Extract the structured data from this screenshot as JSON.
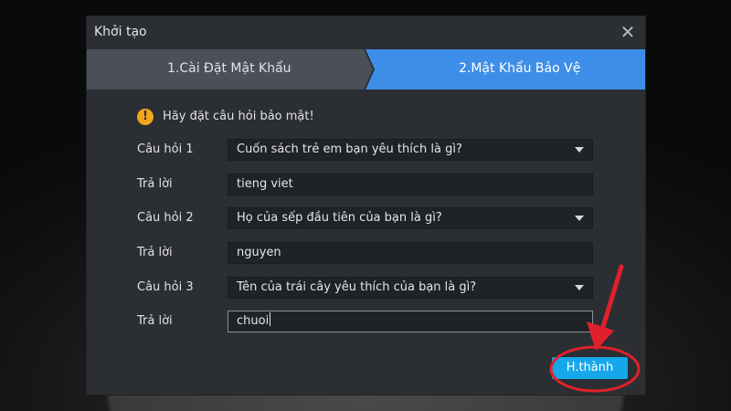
{
  "dialog": {
    "title": "Khởi tạo",
    "close_glyph": "✕"
  },
  "steps": [
    {
      "label": "1.Cài Đặt Mật Khẩu",
      "active": false
    },
    {
      "label": "2.Mật Khẩu Bảo Vệ",
      "active": true
    }
  ],
  "notice": {
    "icon": "warning-icon",
    "icon_glyph": "!",
    "text": "Hãy đặt câu hỏi bảo mật!"
  },
  "form": {
    "q1_label": "Câu hỏi 1",
    "q1_value": "Cuốn sách trẻ em bạn yêu thích là gì?",
    "a1_label": "Trả lời",
    "a1_value": "tieng viet",
    "q2_label": "Câu hỏi 2",
    "q2_value": "Họ của sếp đầu tiên của bạn là gì?",
    "a2_label": "Trả lời",
    "a2_value": "nguyen",
    "q3_label": "Câu hỏi 3",
    "q3_value": "Tên của trái cây yêu thích của bạn là gì?",
    "a3_label": "Trả lời",
    "a3_value": "chuoi"
  },
  "finish_button": {
    "label": "H.thành"
  },
  "colors": {
    "dialog_bg": "#2b2e33",
    "active_step": "#3d8ee8",
    "inactive_step": "#4b5058",
    "finish_button": "#16a7ea",
    "warning": "#f2a61d",
    "annotation": "#e0212b"
  }
}
